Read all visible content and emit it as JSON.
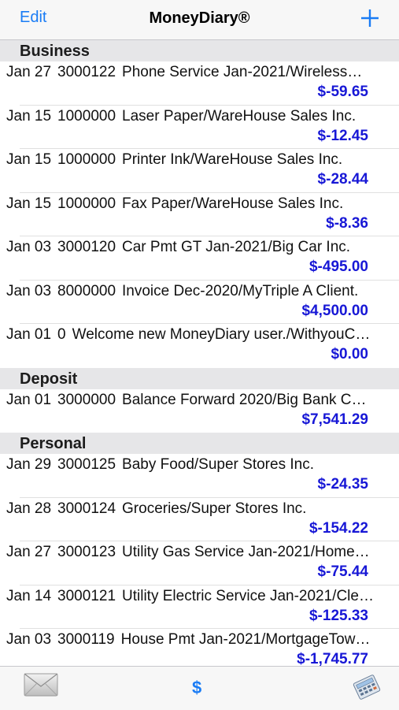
{
  "navbar": {
    "edit_label": "Edit",
    "title": "MoneyDiary®",
    "add_icon": "plus-icon"
  },
  "sections": [
    {
      "title": "Business",
      "rows": [
        {
          "date": "Jan 27",
          "ref": "3000122",
          "desc": "Phone Service Jan-2021/Wireless…",
          "amount": "$-59.65"
        },
        {
          "date": "Jan 15",
          "ref": "1000000",
          "desc": "Laser Paper/WareHouse Sales Inc.",
          "amount": "$-12.45"
        },
        {
          "date": "Jan 15",
          "ref": "1000000",
          "desc": "Printer Ink/WareHouse Sales Inc.",
          "amount": "$-28.44"
        },
        {
          "date": "Jan 15",
          "ref": "1000000",
          "desc": "Fax Paper/WareHouse Sales Inc.",
          "amount": "$-8.36"
        },
        {
          "date": "Jan 03",
          "ref": "3000120",
          "desc": "Car Pmt GT Jan-2021/Big Car Inc.",
          "amount": "$-495.00"
        },
        {
          "date": "Jan 03",
          "ref": "8000000",
          "desc": "Invoice Dec-2020/MyTriple A Client.",
          "amount": "$4,500.00"
        },
        {
          "date": "Jan 01",
          "ref": "0",
          "desc": "Welcome new MoneyDiary user./WithyouC…",
          "amount": "$0.00"
        }
      ]
    },
    {
      "title": "Deposit",
      "rows": [
        {
          "date": "Jan 01",
          "ref": "3000000",
          "desc": "Balance Forward 2020/Big Bank C…",
          "amount": "$7,541.29"
        }
      ]
    },
    {
      "title": "Personal",
      "rows": [
        {
          "date": "Jan 29",
          "ref": "3000125",
          "desc": "Baby Food/Super Stores Inc.",
          "amount": "$-24.35"
        },
        {
          "date": "Jan 28",
          "ref": "3000124",
          "desc": "Groceries/Super Stores Inc.",
          "amount": "$-154.22"
        },
        {
          "date": "Jan 27",
          "ref": "3000123",
          "desc": "Utility Gas Service Jan-2021/Home…",
          "amount": "$-75.44"
        },
        {
          "date": "Jan 14",
          "ref": "3000121",
          "desc": "Utility Electric Service Jan-2021/Cle…",
          "amount": "$-125.33"
        },
        {
          "date": "Jan 03",
          "ref": "3000119",
          "desc": "House Pmt Jan-2021/MortgageTow…",
          "amount": "$-1,745.77"
        }
      ]
    }
  ],
  "tabbar": {
    "mail_icon": "envelope-icon",
    "dollar_label": "$",
    "calc_icon": "calculator-icon"
  },
  "colors": {
    "accent": "#1a7cf5",
    "amount": "#1717d6",
    "section_bg": "#e6e6e8"
  }
}
